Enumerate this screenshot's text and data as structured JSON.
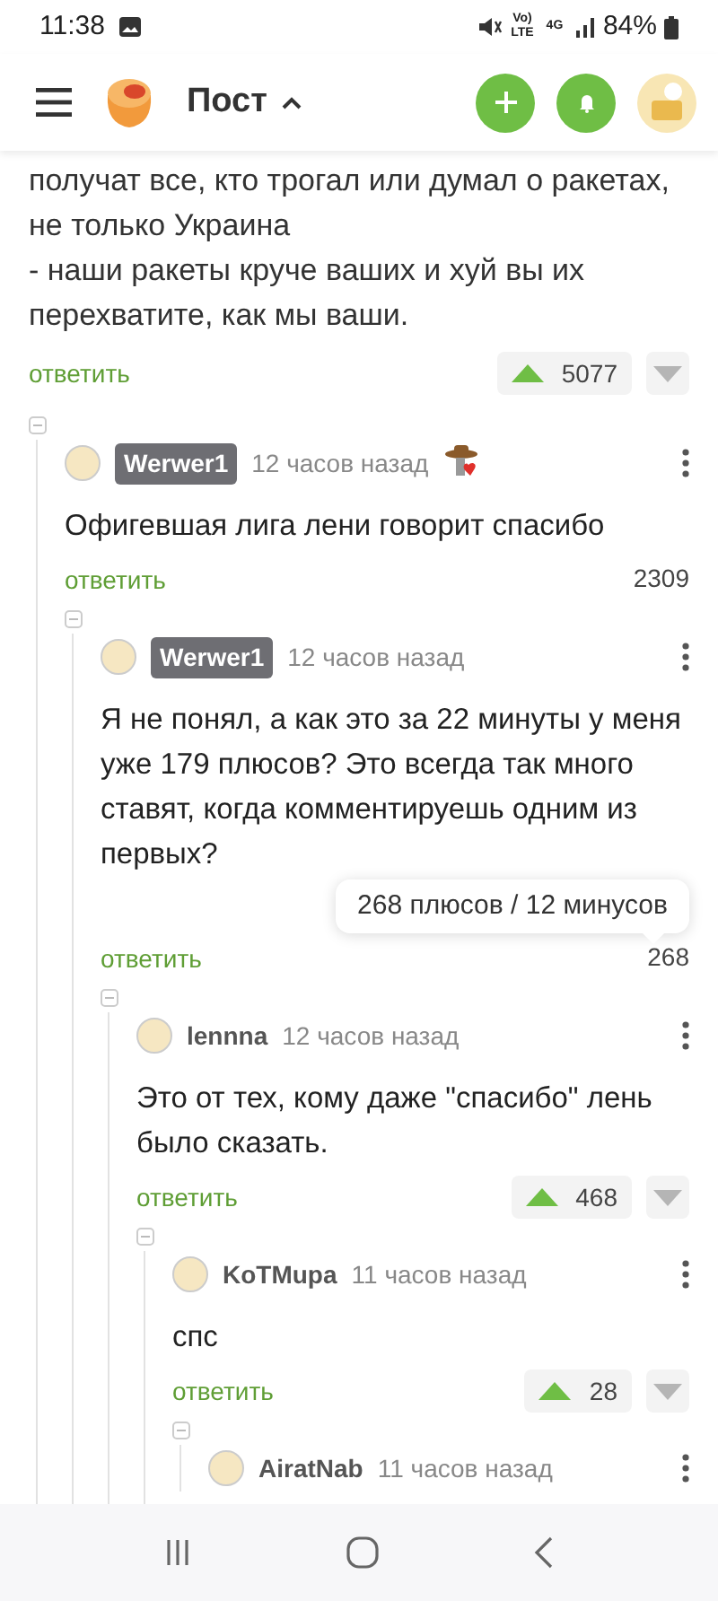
{
  "status_bar": {
    "time": "11:38",
    "network_labels": [
      "Vo) LTE",
      "4G"
    ],
    "battery": "84%"
  },
  "header": {
    "title": "Пост"
  },
  "post": {
    "paragraphs": [
      "получат все, кто трогал или думал о ракетах, не только Украина",
      "- наши ракеты круче ваших и хуй вы их перехватите, как мы ваши."
    ],
    "reply": "ответить",
    "rating": "5077",
    "vote_buttons": true
  },
  "comments": [
    {
      "author": "Werwer1",
      "is_post_author": true,
      "time": "12 часов назад",
      "award": true,
      "expanded": true,
      "text": "Офигевшая лига лени говорит спасибо",
      "reply": "ответить",
      "rating": "2309",
      "vote_buttons": false,
      "children": [
        {
          "author": "Werwer1",
          "is_post_author": true,
          "time": "12 часов назад",
          "award": false,
          "expanded": true,
          "text": "Я не понял, а как это за 22 минуты у меня уже 179 плюсов? Это всегда так много ставят, когда комментируешь одним из первых?",
          "reply": "ответить",
          "rating": "268",
          "vote_buttons": false,
          "tooltip": "268 плюсов / 12 минусов",
          "children": [
            {
              "author": "lennna",
              "is_post_author": false,
              "time": "12 часов назад",
              "award": false,
              "expanded": true,
              "text": "Это от тех, кому даже \"спасибо\" лень было сказать.",
              "reply": "ответить",
              "rating": "468",
              "vote_buttons": true,
              "children": [
                {
                  "author": "KoTMupa",
                  "is_post_author": false,
                  "time": "11 часов назад",
                  "award": false,
                  "expanded": true,
                  "text": "спс",
                  "reply": "ответить",
                  "rating": "28",
                  "vote_buttons": true,
                  "children": [
                    {
                      "author": "AiratNab",
                      "is_post_author": false,
                      "time": "11 часов назад",
                      "award": false,
                      "expanded": true
                    }
                  ]
                }
              ]
            }
          ]
        }
      ]
    }
  ]
}
